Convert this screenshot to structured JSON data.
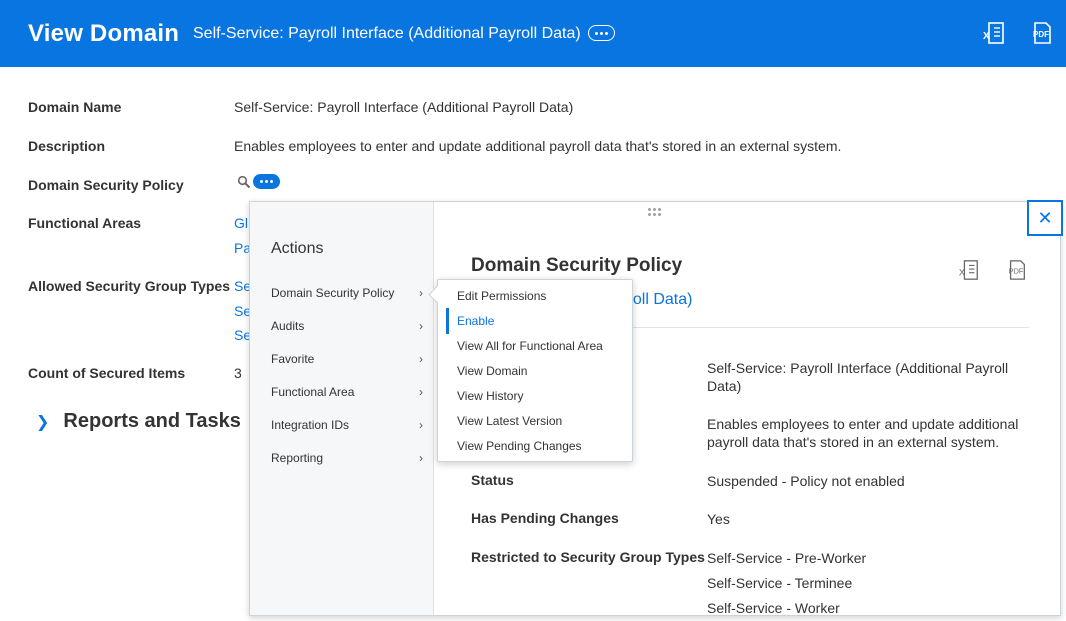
{
  "header": {
    "title": "View Domain",
    "subtitle": "Self-Service: Payroll Interface (Additional Payroll Data)",
    "related_actions_icon": "ellipsis-icon",
    "export_excel_icon": "excel-export-icon",
    "export_pdf_icon": "pdf-export-icon",
    "accent_color": "#0875e1"
  },
  "fields": {
    "domain_name_label": "Domain Name",
    "domain_name_value": "Self-Service: Payroll Interface (Additional Payroll Data)",
    "description_label": "Description",
    "description_value": "Enables employees to enter and update additional payroll data that's stored in an external system.",
    "policy_label": "Domain Security Policy",
    "functional_areas_label": "Functional Areas",
    "functional_areas_values": [
      "Gl",
      "Pa"
    ],
    "allowed_group_types_label": "Allowed Security Group Types",
    "allowed_group_types_values": [
      "Se",
      "Se",
      "Se"
    ],
    "count_label": "Count of Secured Items",
    "count_value": "3"
  },
  "reports": {
    "label": "Reports and Tasks"
  },
  "actions_panel": {
    "heading": "Actions",
    "items": [
      "Domain Security Policy",
      "Audits",
      "Favorite",
      "Functional Area",
      "Integration IDs",
      "Reporting"
    ]
  },
  "submenu": {
    "items": [
      "Edit Permissions",
      "Enable",
      "View All for Functional Area",
      "View Domain",
      "View History",
      "View Latest Version",
      "View Pending Changes"
    ],
    "active": "Enable"
  },
  "detail": {
    "title": "Domain Security Policy",
    "subtitle_visible": "erface (Additional Payroll Data)",
    "domain_value": "Self-Service: Payroll Interface (Additional Payroll Data)",
    "description_value": "Enables employees to enter and update additional payroll data that's stored in an external system.",
    "status_label": "Status",
    "status_value": "Suspended - Policy not enabled",
    "pending_label": "Has Pending Changes",
    "pending_value": "Yes",
    "restricted_label": "Restricted to Security Group Types",
    "restricted_values": [
      "Self-Service - Pre-Worker",
      "Self-Service - Terminee",
      "Self-Service - Worker"
    ]
  }
}
